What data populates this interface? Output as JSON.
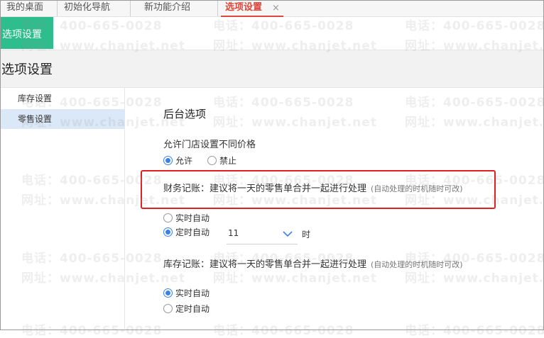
{
  "tabs": [
    {
      "label": "我的桌面"
    },
    {
      "label": "初始化导航"
    },
    {
      "label": "新功能介绍"
    },
    {
      "label": "选项设置",
      "active": true
    }
  ],
  "tab_close_glyph": "×",
  "page_tag": "选项设置",
  "header_title": "选项设置",
  "sidebar": [
    {
      "label": "库存设置"
    },
    {
      "label": "零售设置",
      "active": true
    }
  ],
  "main": {
    "section_title": "后台选项",
    "price_setting": {
      "label": "允许门店设置不同价格",
      "options": [
        {
          "label": "允许",
          "checked": true
        },
        {
          "label": "禁止",
          "checked": false
        }
      ]
    },
    "finance": {
      "label": "财务记账：建议将一天的零售单合并一起进行处理",
      "hint": "(自动处理的时机随时可改)",
      "options": [
        {
          "label": "实时自动",
          "checked": false
        },
        {
          "label": "定时自动",
          "checked": true
        }
      ],
      "hour_value": "11",
      "hour_unit": "时"
    },
    "inventory": {
      "label": "库存记账：建议将一天的零售单合并一起进行处理",
      "hint": "(自动处理的时机随时可改)",
      "options": [
        {
          "label": "实时自动",
          "checked": true
        },
        {
          "label": "定时自动",
          "checked": false
        }
      ]
    }
  },
  "watermark": {
    "phone": "电话：400-665-0028",
    "site": "网址：www.chanjet.net"
  },
  "colors": {
    "accent_green": "#2ebd8c",
    "active_tab_red": "#e0463b",
    "highlight_box": "#e02020",
    "radio_blue": "#3b82e8",
    "sidebar_active": "#dbe8f7"
  },
  "icons": {
    "tab_close": "close-icon",
    "select": "chevron-down-icon"
  }
}
